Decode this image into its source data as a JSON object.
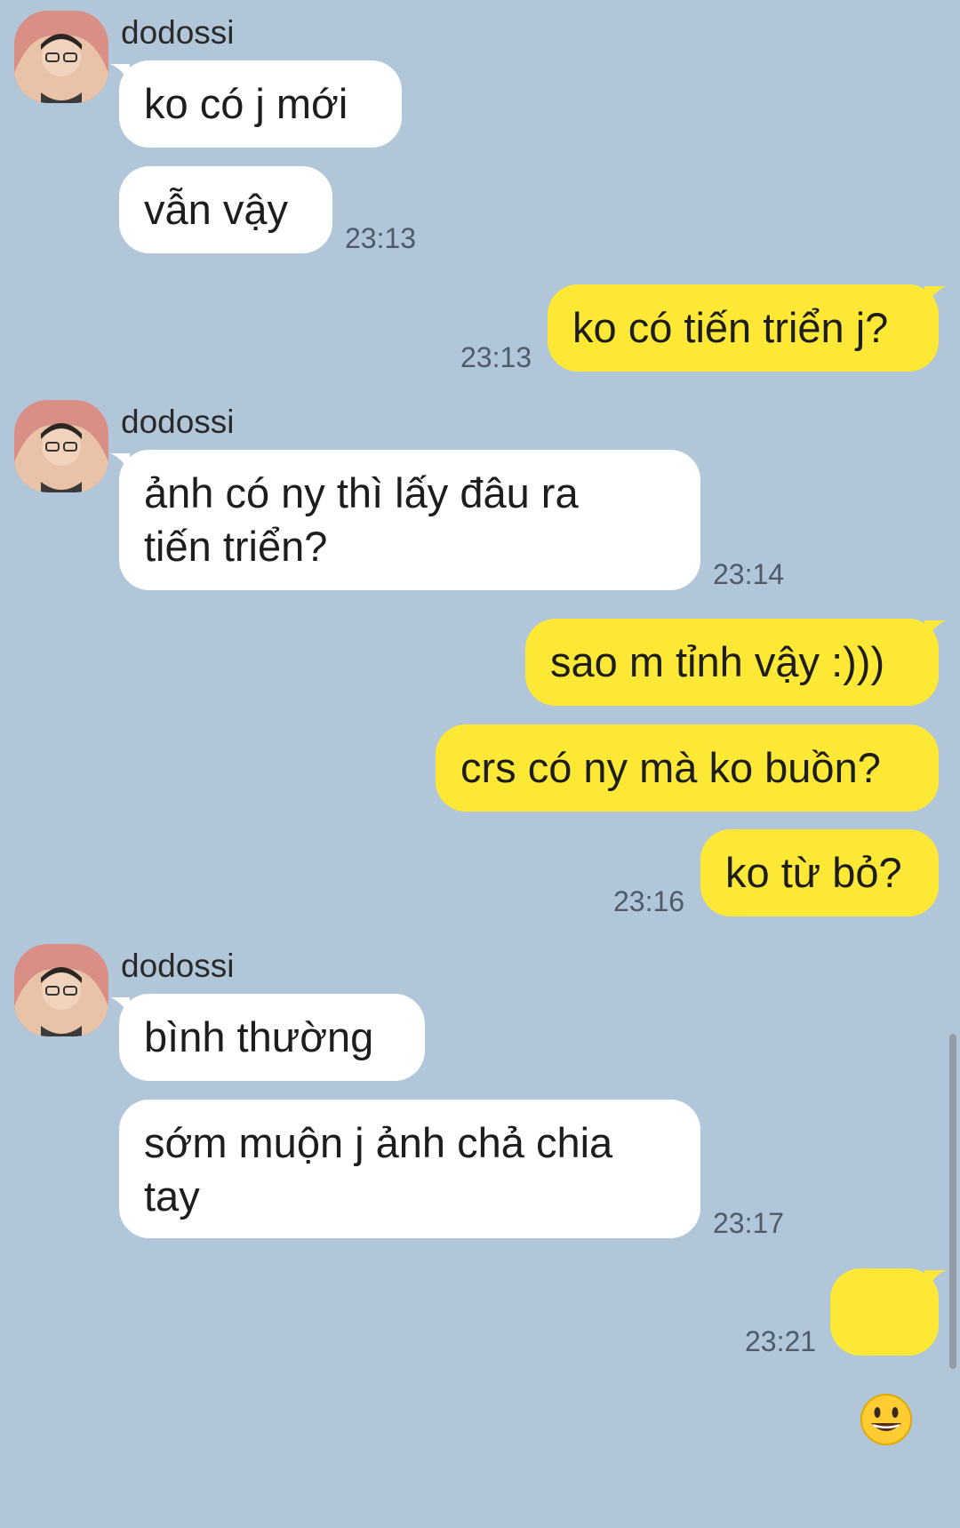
{
  "conversation": {
    "sender_name": "dodossi",
    "messages": [
      {
        "from": "them",
        "text": "ko có j mới"
      },
      {
        "from": "them",
        "text": "vẫn vậy",
        "time": "23:13"
      },
      {
        "from": "me",
        "text": "ko có tiến triển j?",
        "time": "23:13"
      },
      {
        "from": "them",
        "text": "ảnh có ny thì lấy đâu ra\ntiến triển?",
        "time": "23:14"
      },
      {
        "from": "me",
        "text": "sao m tỉnh vậy :)))"
      },
      {
        "from": "me",
        "text": "crs có ny mà ko buồn?"
      },
      {
        "from": "me",
        "text": "ko từ bỏ?",
        "time": "23:16"
      },
      {
        "from": "them",
        "text": "bình thường"
      },
      {
        "from": "them",
        "text": "sớm muộn j ảnh chả chia\ntay",
        "time": "23:17"
      },
      {
        "from": "me",
        "text": "",
        "emoji": "grinning-face",
        "time": "23:21"
      }
    ]
  },
  "colors": {
    "background": "#b2c6da",
    "incoming_bubble": "#ffffff",
    "outgoing_bubble": "#fde835"
  }
}
